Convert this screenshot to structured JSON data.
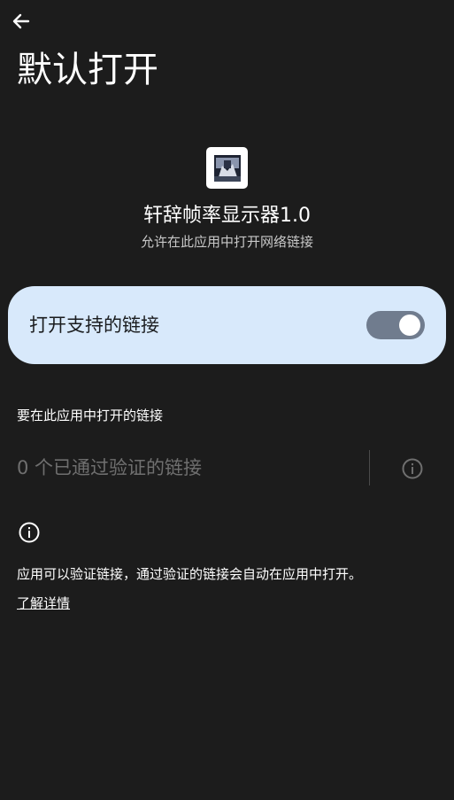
{
  "header": {
    "back_icon": "arrow-left-icon",
    "title": "默认打开"
  },
  "app": {
    "icon": "app-icon",
    "name": "轩辞帧率显示器1.0",
    "subtitle": "允许在此应用中打开网络链接"
  },
  "open_supported_links": {
    "label": "打开支持的链接",
    "enabled": true
  },
  "links_section": {
    "header": "要在此应用中打开的链接",
    "verified_links": "0 个已通过验证的链接",
    "info_icon": "info-icon"
  },
  "footer": {
    "info_icon": "info-icon",
    "description": "应用可以验证链接，通过验证的链接会自动在应用中打开。",
    "learn_more": "了解详情"
  },
  "colors": {
    "background": "#1c1c1c",
    "card": "#d8e9fb",
    "switch_track": "#707c8e",
    "muted_text": "#6f6f6f"
  }
}
